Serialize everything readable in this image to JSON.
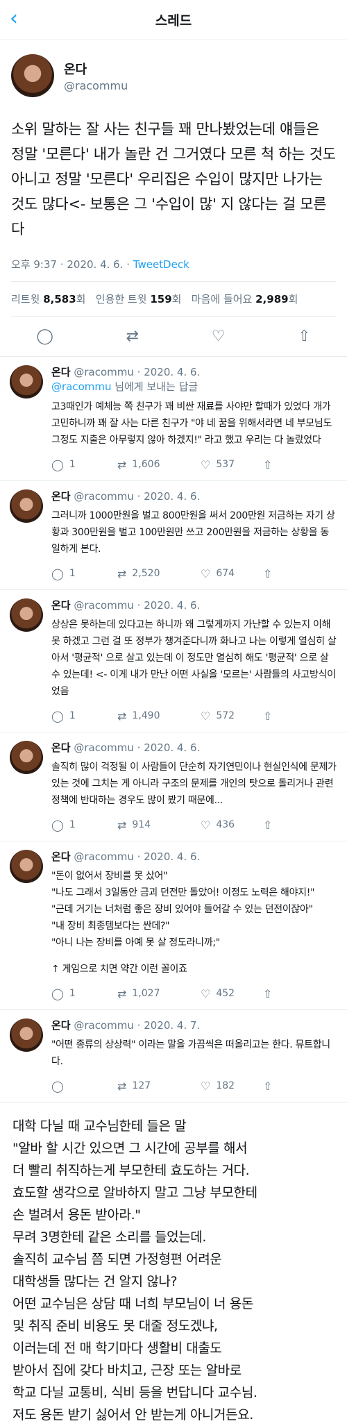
{
  "nav": {
    "back_icon": "‹",
    "title": "스레드"
  },
  "main": {
    "display_name": "온다",
    "handle": "@racommu",
    "text": "소위 말하는 잘 사는 친구들 꽤 만나봤었는데 얘들은 정말 '모른다' 내가 놀란 건 그거였다 모른 척 하는 것도 아니고 정말 '모른다' 우리집은 수입이 많지만 나가는 것도 많다<- 보통은 그 '수입이 많' 지 않다는 걸 모른다",
    "time": "오후 9:37 · 2020. 4. 6. · ",
    "app": "TweetDeck",
    "retweet_label": "리트윗",
    "retweet_count": "8,583",
    "retweet_unit": "회",
    "quote_label": "인용한 트윗",
    "quote_count": "159",
    "quote_unit": "회",
    "like_label": "마음에 들어요",
    "like_count": "2,989",
    "like_unit": "회"
  },
  "replies": [
    {
      "name": "온다",
      "handle": "@racommu · 2020. 4. 6.",
      "reply_to": "@racommu",
      "reply_to_suffix": " 님에게 보내는 답글",
      "text": "고3때인가 예체능 쪽 친구가 꽤 비싼 재료를 사야만 할때가 있었다 개가 고민하니까 꽤 잘 사는 다른 친구가 \"야 네 꿈을 위해서라면 네 부모님도 그정도 지출은 아무렇지 않아 하겠지!\" 라고 했고 우리는 다 놀랐었다",
      "replies": "1",
      "retweets": "1,606",
      "likes": "537"
    },
    {
      "name": "온다",
      "handle": "@racommu · 2020. 4. 6.",
      "text": "그러니까 1000만원을 벌고 800만원을 써서 200만원 저금하는 자기 상황과 300만원을 벌고 100만원만 쓰고 200만원을 저금하는 상황을 동일하게 본다.",
      "replies": "1",
      "retweets": "2,520",
      "likes": "674"
    },
    {
      "name": "온다",
      "handle": "@racommu · 2020. 4. 6.",
      "text": "상상은 못하는데 있다고는 하니까 왜 그렇게까지 가난할 수 있는지 이해 못 하겠고 그런 걸 또 정부가 챙겨준다니까 화나고 나는 이렇게 열심히 살아서 '평균적' 으로 살고 있는데 이 정도만 열심히 해도 '평균적' 으로 살 수 있는데! <- 이게 내가 만난 어떤 사실을 '모르는' 사람들의 사고방식이었음",
      "replies": "1",
      "retweets": "1,490",
      "likes": "572"
    },
    {
      "name": "온다",
      "handle": "@racommu · 2020. 4. 6.",
      "text": "솔직히 많이 걱정될 이 사람들이 단순히 자기연민이나 현실인식에 문제가 있는 것에 그치는 게 아니라 구조의 문제를 개인의 탓으로 돌리거나 관련 정책에 반대하는 경우도 많이 봤기 때문에...",
      "replies": "1",
      "retweets": "914",
      "likes": "436"
    },
    {
      "name": "온다",
      "handle": "@racommu · 2020. 4. 6.",
      "lines": [
        "\"돈이 없어서 장비를 못 샀어\"",
        "\"나도 그래서 3일동안 금괴 던전만 돌았어! 이정도 노력은 해야지!\"",
        "\"근데 거기는 너처럼 좋은 장비 있어야 들어갈 수 있는 던전이잖아\"",
        "\"내 장비 최종템보다는 싼데?\"",
        "\"아니 나는 장비를 아예 못 살 정도라니까;\"",
        "",
        "↑ 게임으로 치면 약간 이런 꼴이죠"
      ],
      "replies": "1",
      "retweets": "1,027",
      "likes": "452"
    },
    {
      "name": "온다",
      "handle": "@racommu · 2020. 4. 7.",
      "text": "\"어떤 종류의 상상력\" 이라는 말을 가끔씩은 떠올리고는 한다. 뮤트합니다.",
      "replies": "",
      "retweets": "127",
      "likes": "182"
    }
  ],
  "caption": [
    "대학 다닐 때 교수님한테 들은 말",
    "\"알바 할 시간 있으면 그 시간에 공부를 해서",
    "더 빨리 취직하는게 부모한테 효도하는 거다.",
    "효도할 생각으로 알바하지 말고 그냥 부모한테",
    "손 벌려서 용돈 받아라.\"",
    "무려 3명한테 같은 소리를 들었는데.",
    "솔직히 교수님 쯤 되면 가정형편 어려운",
    "대학생들 많다는 건 알지 않나?",
    "어떤 교수님은 상담 때 너희 부모님이 너 용돈",
    "및 취직 준비 비용도 못 대줄 정도겠냐,",
    "이러는데 전 매 학기마다 생활비 대출도",
    "받아서 집에 갖다 바치고, 근장 또는 알바로",
    "학교 다닐 교통비, 식비 등을 번답니다 교수님.",
    "저도 용돈 받기 싫어서 안 받는게 아니거든요."
  ]
}
